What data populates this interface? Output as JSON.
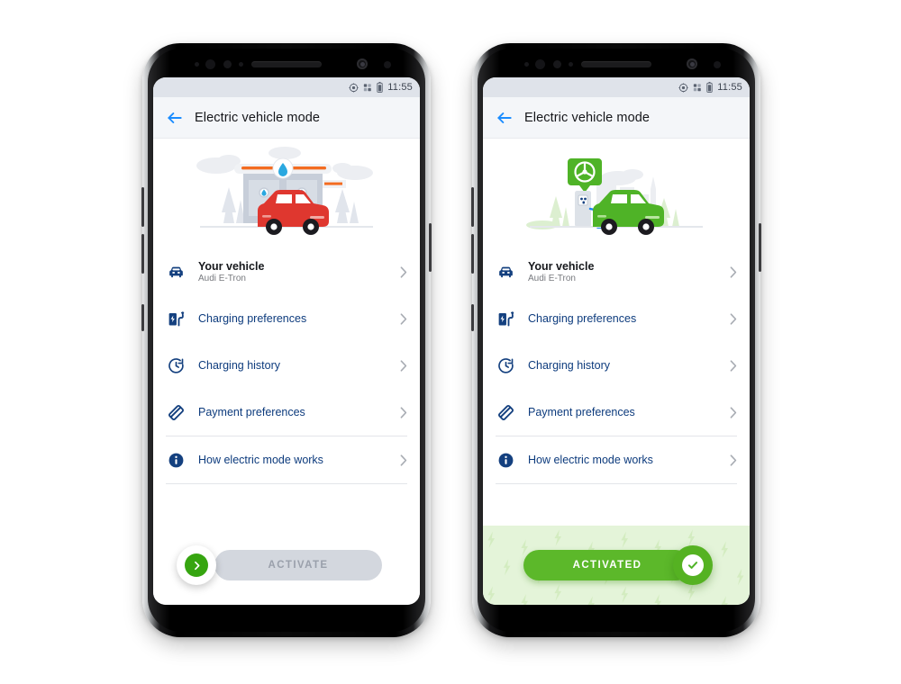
{
  "page": {
    "background": "#ffffff",
    "accent_blue": "#0d3b7d",
    "accent_green": "#5cb82a",
    "link_blue": "#1a8cff"
  },
  "phones": [
    {
      "id": "phone-inactive",
      "status_bar": {
        "icons": [
          "location-icon",
          "network-icon",
          "battery-icon"
        ],
        "time": "11:55"
      },
      "appbar": {
        "back_label": "back-arrow-icon",
        "title": "Electric vehicle mode"
      },
      "hero": {
        "illustration": "gas-station-with-red-car-illustration",
        "car_color": "#e03a33",
        "station_color": "#c3cbd8"
      },
      "list": [
        {
          "icon": "car-front-icon",
          "title": "Your vehicle",
          "subtitle": "Audi E-Tron",
          "strong": true
        },
        {
          "icon": "charging-station-icon",
          "title": "Charging preferences",
          "subtitle": "",
          "strong": false
        },
        {
          "icon": "history-clock-icon",
          "title": "Charging history",
          "subtitle": "",
          "strong": false
        },
        {
          "icon": "payment-tag-icon",
          "title": "Payment preferences",
          "subtitle": "",
          "strong": false
        },
        {
          "icon": "info-circle-icon",
          "title": "How electric mode works",
          "subtitle": "",
          "strong": false
        }
      ],
      "action": {
        "state": "inactive",
        "label": "ACTIVATE",
        "knob_icon": "chevron-right-green-icon",
        "track_color": "#d3d7de",
        "label_color": "#9aa0ab"
      }
    },
    {
      "id": "phone-activated",
      "status_bar": {
        "icons": [
          "location-icon",
          "network-icon",
          "battery-icon"
        ],
        "time": "11:55"
      },
      "appbar": {
        "back_label": "back-arrow-icon",
        "title": "Electric vehicle mode"
      },
      "hero": {
        "illustration": "ev-charger-with-green-car-illustration",
        "car_color": "#4fb327",
        "pin_color": "#4fb327"
      },
      "list": [
        {
          "icon": "car-front-icon",
          "title": "Your vehicle",
          "subtitle": "Audi E-Tron",
          "strong": true
        },
        {
          "icon": "charging-station-icon",
          "title": "Charging preferences",
          "subtitle": "",
          "strong": false
        },
        {
          "icon": "history-clock-icon",
          "title": "Charging history",
          "subtitle": "",
          "strong": false
        },
        {
          "icon": "payment-tag-icon",
          "title": "Payment preferences",
          "subtitle": "",
          "strong": false
        },
        {
          "icon": "info-circle-icon",
          "title": "How electric mode works",
          "subtitle": "",
          "strong": false
        }
      ],
      "action": {
        "state": "activated",
        "label": "ACTIVATED",
        "knob_icon": "check-circle-white-icon",
        "track_color": "#5cb82a",
        "label_color": "#ffffff",
        "panel_background": "#e4f4d9",
        "panel_pattern": "lightning-bolt-pattern"
      }
    }
  ]
}
